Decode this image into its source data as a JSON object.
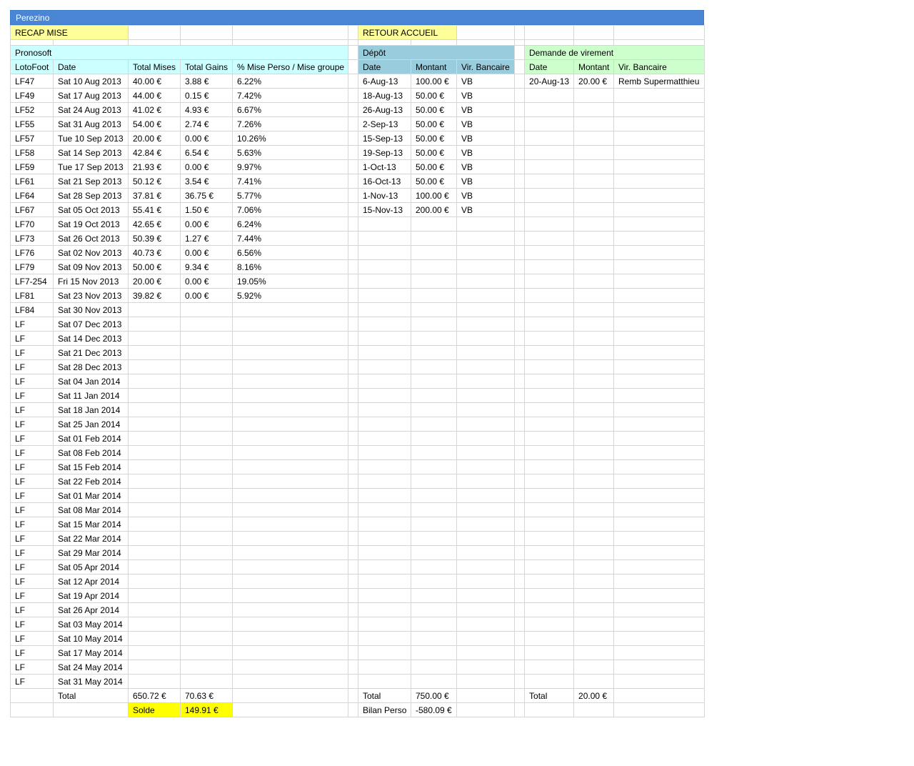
{
  "title": "Perezino",
  "buttons": {
    "recap": "RECAP MISE",
    "retour": "RETOUR ACCUEIL"
  },
  "sections": {
    "pronosoft": "Pronosoft",
    "depot": "Dépôt",
    "virement": "Demande de virement"
  },
  "headers": {
    "pronosoft": [
      "LotoFoot",
      "Date",
      "Total Mises",
      "Total Gains",
      "% Mise Perso / Mise groupe"
    ],
    "depot": [
      "Date",
      "Montant",
      "Vir. Bancaire"
    ],
    "virement": [
      "Date",
      "Montant",
      "Vir. Bancaire"
    ]
  },
  "pronosoft_rows": [
    [
      "LF47",
      "Sat 10 Aug 2013",
      "40.00 €",
      "3.88 €",
      "6.22%"
    ],
    [
      "LF49",
      "Sat 17 Aug 2013",
      "44.00 €",
      "0.15 €",
      "7.42%"
    ],
    [
      "LF52",
      "Sat 24 Aug 2013",
      "41.02 €",
      "4.93 €",
      "6.67%"
    ],
    [
      "LF55",
      "Sat 31 Aug 2013",
      "54.00 €",
      "2.74 €",
      "7.26%"
    ],
    [
      "LF57",
      "Tue 10 Sep 2013",
      "20.00 €",
      "0.00 €",
      "10.26%"
    ],
    [
      "LF58",
      "Sat 14 Sep 2013",
      "42.84 €",
      "6.54 €",
      "5.63%"
    ],
    [
      "LF59",
      "Tue 17 Sep 2013",
      "21.93 €",
      "0.00 €",
      "9.97%"
    ],
    [
      "LF61",
      "Sat 21 Sep 2013",
      "50.12 €",
      "3.54 €",
      "7.41%"
    ],
    [
      "LF64",
      "Sat 28 Sep 2013",
      "37.81 €",
      "36.75 €",
      "5.77%"
    ],
    [
      "LF67",
      "Sat 05 Oct 2013",
      "55.41 €",
      "1.50 €",
      "7.06%"
    ],
    [
      "LF70",
      "Sat 19 Oct 2013",
      "42.65 €",
      "0.00 €",
      "6.24%"
    ],
    [
      "LF73",
      "Sat 26 Oct 2013",
      "50.39 €",
      "1.27 €",
      "7.44%"
    ],
    [
      "LF76",
      "Sat 02 Nov 2013",
      "40.73 €",
      "0.00 €",
      "6.56%"
    ],
    [
      "LF79",
      "Sat 09 Nov 2013",
      "50.00 €",
      "9.34 €",
      "8.16%"
    ],
    [
      "LF7-254",
      "Fri 15 Nov 2013",
      "20.00 €",
      "0.00 €",
      "19.05%"
    ],
    [
      "LF81",
      "Sat 23 Nov 2013",
      "39.82 €",
      "0.00 €",
      "5.92%"
    ],
    [
      "LF84",
      "Sat 30 Nov 2013",
      "",
      "",
      ""
    ],
    [
      "LF",
      "Sat 07 Dec 2013",
      "",
      "",
      ""
    ],
    [
      "LF",
      "Sat 14 Dec 2013",
      "",
      "",
      ""
    ],
    [
      "LF",
      "Sat 21 Dec 2013",
      "",
      "",
      ""
    ],
    [
      "LF",
      "Sat 28 Dec 2013",
      "",
      "",
      ""
    ],
    [
      "LF",
      "Sat 04 Jan 2014",
      "",
      "",
      ""
    ],
    [
      "LF",
      "Sat 11 Jan 2014",
      "",
      "",
      ""
    ],
    [
      "LF",
      "Sat 18 Jan 2014",
      "",
      "",
      ""
    ],
    [
      "LF",
      "Sat 25 Jan 2014",
      "",
      "",
      ""
    ],
    [
      "LF",
      "Sat 01 Feb 2014",
      "",
      "",
      ""
    ],
    [
      "LF",
      "Sat 08 Feb 2014",
      "",
      "",
      ""
    ],
    [
      "LF",
      "Sat 15 Feb 2014",
      "",
      "",
      ""
    ],
    [
      "LF",
      "Sat 22 Feb 2014",
      "",
      "",
      ""
    ],
    [
      "LF",
      "Sat 01 Mar 2014",
      "",
      "",
      ""
    ],
    [
      "LF",
      "Sat 08 Mar 2014",
      "",
      "",
      ""
    ],
    [
      "LF",
      "Sat 15 Mar 2014",
      "",
      "",
      ""
    ],
    [
      "LF",
      "Sat 22 Mar 2014",
      "",
      "",
      ""
    ],
    [
      "LF",
      "Sat 29 Mar 2014",
      "",
      "",
      ""
    ],
    [
      "LF",
      "Sat 05 Apr 2014",
      "",
      "",
      ""
    ],
    [
      "LF",
      "Sat 12 Apr 2014",
      "",
      "",
      ""
    ],
    [
      "LF",
      "Sat 19 Apr 2014",
      "",
      "",
      ""
    ],
    [
      "LF",
      "Sat 26 Apr 2014",
      "",
      "",
      ""
    ],
    [
      "LF",
      "Sat 03 May 2014",
      "",
      "",
      ""
    ],
    [
      "LF",
      "Sat 10 May 2014",
      "",
      "",
      ""
    ],
    [
      "LF",
      "Sat 17 May 2014",
      "",
      "",
      ""
    ],
    [
      "LF",
      "Sat 24 May 2014",
      "",
      "",
      ""
    ],
    [
      "LF",
      "Sat 31 May 2014",
      "",
      "",
      ""
    ]
  ],
  "depot_rows": [
    [
      "6-Aug-13",
      "100.00 €",
      "VB"
    ],
    [
      "18-Aug-13",
      "50.00 €",
      "VB"
    ],
    [
      "26-Aug-13",
      "50.00 €",
      "VB"
    ],
    [
      "2-Sep-13",
      "50.00 €",
      "VB"
    ],
    [
      "15-Sep-13",
      "50.00 €",
      "VB"
    ],
    [
      "19-Sep-13",
      "50.00 €",
      "VB"
    ],
    [
      "1-Oct-13",
      "50.00 €",
      "VB"
    ],
    [
      "16-Oct-13",
      "50.00 €",
      "VB"
    ],
    [
      "1-Nov-13",
      "100.00 €",
      "VB"
    ],
    [
      "15-Nov-13",
      "200.00 €",
      "VB"
    ]
  ],
  "virement_rows": [
    [
      "20-Aug-13",
      "20.00 €",
      "Remb Supermatthieu"
    ]
  ],
  "totals": {
    "label": "Total",
    "mises": "650.72 €",
    "gains": "70.63 €",
    "depot_label": "Total",
    "depot": "750.00 €",
    "virement_label": "Total",
    "virement": "20.00 €"
  },
  "solde": {
    "label": "Solde",
    "value": "149.91 €"
  },
  "bilan": {
    "label": "Bilan Perso",
    "value": "-580.09 €"
  },
  "colors": {
    "titlebar": "#4a86d4",
    "yellow": "#ffff99",
    "cyan": "#ccffff",
    "blue": "#99ccdd",
    "green": "#ccffcc"
  }
}
